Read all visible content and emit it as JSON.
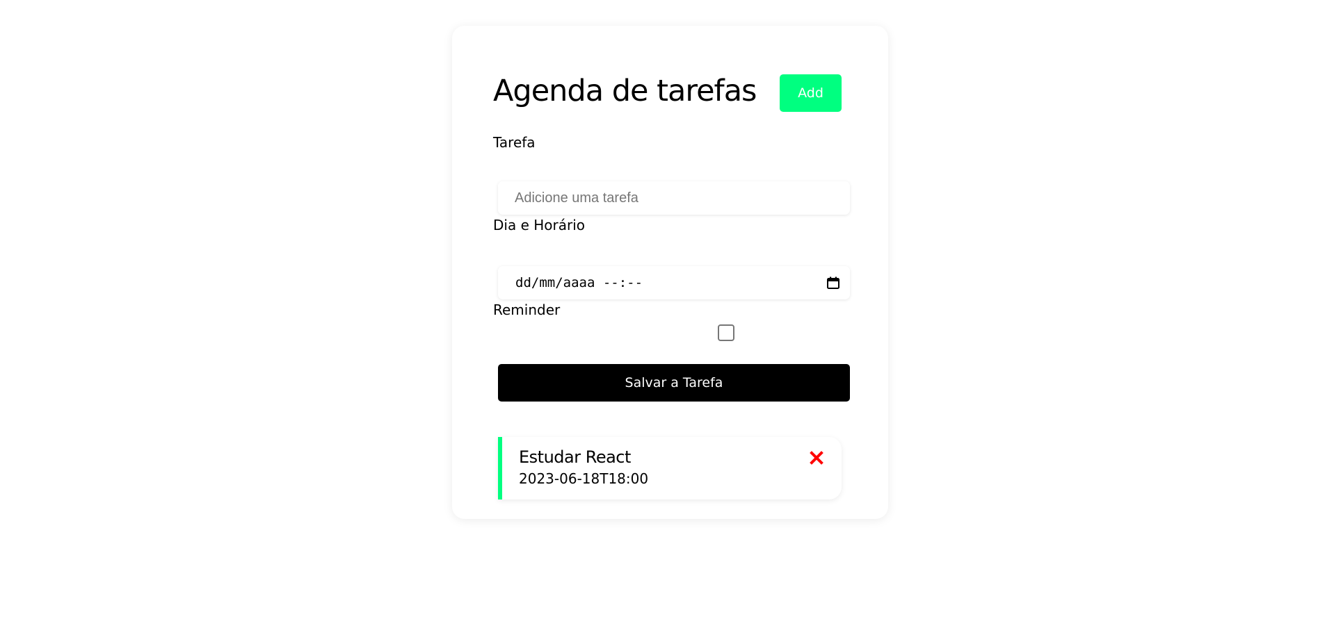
{
  "header": {
    "title": "Agenda de tarefas",
    "add_label": "Add"
  },
  "form": {
    "task_label": "Tarefa",
    "task_placeholder": "Adicione uma tarefa",
    "task_value": "",
    "datetime_label": "Dia e Horário",
    "datetime_value": "dd/mm/aaaa --:--",
    "reminder_label": "Reminder",
    "reminder_checked": false,
    "save_label": "Salvar a Tarefa"
  },
  "tasks": [
    {
      "title": "Estudar React",
      "datetime": "2023-06-18T18:00",
      "reminder": true
    }
  ],
  "icons": {
    "datetime_picker": "calendar-icon",
    "task_delete": "close-icon"
  },
  "colors": {
    "accent": "#00ff80",
    "reminder_border": "#00ff80",
    "delete": "#ff0000",
    "save_button": "#000000"
  }
}
